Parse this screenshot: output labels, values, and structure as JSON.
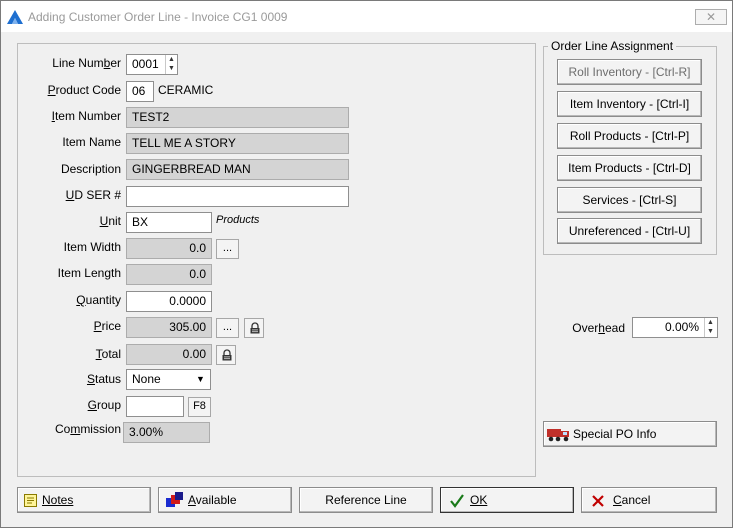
{
  "window": {
    "title": "Adding Customer Order Line - Invoice CG1 0009",
    "close_label": "✕"
  },
  "form": {
    "line_number": {
      "label": "Line Number",
      "value": "0001"
    },
    "product_code": {
      "label": "Product Code",
      "value": "06",
      "description": "CERAMIC"
    },
    "item_number": {
      "label": "Item Number",
      "value": "TEST2"
    },
    "item_name": {
      "label": "Item Name",
      "value": "TELL ME A STORY"
    },
    "description": {
      "label": "Description",
      "value": "GINGERBREAD MAN"
    },
    "ud_ser": {
      "label": "UD SER #",
      "value": ""
    },
    "unit": {
      "label": "Unit",
      "value": "BX",
      "note": "Products"
    },
    "item_width": {
      "label": "Item Width",
      "value": "0.0",
      "button": "..."
    },
    "item_length": {
      "label": "Item Length",
      "value": "0.0"
    },
    "quantity": {
      "label": "Quantity",
      "value": "0.0000"
    },
    "price": {
      "label": "Price",
      "value": "305.00",
      "button": "..."
    },
    "total": {
      "label": "Total",
      "value": "0.00"
    },
    "status": {
      "label": "Status",
      "value": "None"
    },
    "group": {
      "label": "Group",
      "value": "",
      "button": "F8"
    },
    "commission": {
      "label": "Commission",
      "value": "3.00%"
    }
  },
  "assignment": {
    "title": "Order Line Assignment",
    "buttons": [
      {
        "label": "Roll Inventory - [Ctrl-R]"
      },
      {
        "label": "Item Inventory - [Ctrl-I]"
      },
      {
        "label": "Roll Products - [Ctrl-P]"
      },
      {
        "label": "Item Products - [Ctrl-D]"
      },
      {
        "label": "Services - [Ctrl-S]"
      },
      {
        "label": "Unreferenced - [Ctrl-U]"
      }
    ]
  },
  "overhead": {
    "label": "Overhead",
    "value": "0.00%"
  },
  "special_po": {
    "label": "Special PO Info"
  },
  "footer": {
    "notes": "Notes",
    "available": "Available",
    "reference_line": "Reference Line",
    "ok": "OK",
    "cancel": "Cancel"
  },
  "colors": {
    "title_icon": "#1e6fd0",
    "ok_check": "#1a7a1a",
    "cancel_x": "#c00000"
  }
}
